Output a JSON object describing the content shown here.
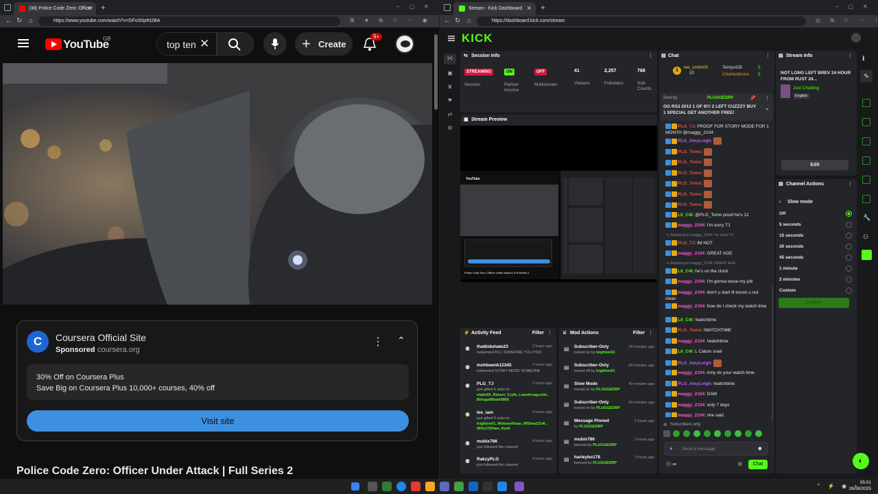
{
  "youtube_window": {
    "tab_title": "(38) Police Code Zero: Officer",
    "url": "https://www.youtube.com/watch?v=DFoS0ptN2BA",
    "logo_text": "YouTube",
    "region": "GB",
    "search_value": "top ten",
    "create_label": "Create",
    "notification_count": "9+",
    "ad": {
      "advertiser": "Coursera Official Site",
      "sponsored": "Sponsored",
      "domain": "coursera.org",
      "avatar_letter": "C",
      "offer_title": "30% Off on Coursera Plus",
      "offer_text": "Save Big on Coursera Plus 10,000+ courses, 40% off",
      "cta": "Visit site"
    },
    "video_title": "Police Code Zero: Officer Under Attack | Full Series 2"
  },
  "kick_window": {
    "tab_title": "Stream - Kick Dashboard",
    "url": "https://dashboard.kick.com/stream",
    "logo": "KICK",
    "session_info": {
      "title": "Session Info",
      "stats": [
        {
          "badge": "STREAMING",
          "label": "Session"
        },
        {
          "badge": "ON",
          "label": "Partner Income"
        },
        {
          "badge": "OFF",
          "label": "Multistream"
        },
        {
          "value": "41",
          "label": "Viewers"
        },
        {
          "value": "2,257",
          "label": "Followers"
        },
        {
          "value": "768",
          "label": "Sub Counts"
        }
      ]
    },
    "stream_preview": {
      "title": "Stream Preview",
      "caption": "Police Code Zero: Officer Under Attack | Full Series 2",
      "mini_logo": "YouTube"
    },
    "activity_feed": {
      "title": "Activity Feed",
      "filter": "Filter",
      "items": [
        {
          "user": "thatkiduhate23",
          "time": "2 hours ago",
          "line1": "redeemed KILL SOMEONE YOU PICK",
          "line2": ""
        },
        {
          "user": "mohbeenk12345",
          "time": "2 hours ago",
          "line1": "redeemed STORY MODE SOMEONE",
          "line2": ""
        },
        {
          "user": "PLG_TJ",
          "time": "2 hours ago",
          "line1": "just gifted 5 subs to:",
          "line2": "slatts55, Rimuri, Crytk, Leandroagustin, BelugaWhale6868"
        },
        {
          "user": "lee_iam",
          "time": "4 hours ago",
          "line1": "just gifted 5 subs to:",
          "line2": "leighton01, MobeenKhan, WDmwZZnK, WHyClSHaw, Ayo6"
        },
        {
          "user": "mubix786",
          "time": "4 hours ago",
          "line1": "just followed the channel",
          "line2": ""
        },
        {
          "user": "RakzyPLG",
          "time": "4 hours ago",
          "line1": "just followed the channel",
          "line2": ""
        }
      ]
    },
    "mod_actions": {
      "title": "Mod Actions",
      "filter": "Filter",
      "items": [
        {
          "action": "Subscriber-Only",
          "time": "39 minutes ago",
          "line": "turned on by",
          "by": "leighton01"
        },
        {
          "action": "Subscriber-Only",
          "time": "40 minutes ago",
          "line": "turned off by",
          "by": "leighton01"
        },
        {
          "action": "Slow Mode",
          "time": "40 minutes ago",
          "line": "turned on by",
          "by": "PLUGGEDRP"
        },
        {
          "action": "Subscriber-Only",
          "time": "43 minutes ago",
          "line": "turned on by",
          "by": "PLUGGEDRP"
        },
        {
          "action": "Message Pinned",
          "time": "2 hours ago",
          "line": "by",
          "by": "PLUGGEDRP"
        },
        {
          "action": "mubix786",
          "time": "3 hours ago",
          "line": "banned by",
          "by": "PLUGGEDRP"
        },
        {
          "action": "harleybo178",
          "time": "3 hours ago",
          "line": "banned by",
          "by": "PLUGGEDRP"
        }
      ]
    },
    "chat": {
      "title": "Chat",
      "top_gifters": [
        {
          "name": "lee_smith05",
          "count": "10"
        },
        {
          "name": "TempoGB",
          "count": "5"
        },
        {
          "name": "Charlesbrono",
          "count": "5"
        }
      ],
      "pinned": {
        "sent_by": "Sent by",
        "sender": "PLUGGEDRP",
        "text": "OG RS3 2012 1 OF 8!!! 2 LEFT CUZZZY BUY 1 SPECIAL GET ANOTHER FREE!"
      },
      "messages": [
        {
          "user": "PLG_TJ",
          "color": "#e84d4d",
          "text": "PROOF FOR STORY MODE FOR 1 MONTH @maggy_2104"
        },
        {
          "user": "PLG_AmyLeigh",
          "color": "#c45cff",
          "text": ""
        },
        {
          "user": "PLG_Tomo",
          "color": "#e84d4d",
          "text": ""
        },
        {
          "user": "PLG_Tomo",
          "color": "#e84d4d",
          "text": ""
        },
        {
          "user": "PLG_Tomo",
          "color": "#e84d4d",
          "text": ""
        },
        {
          "user": "PLG_Tomo",
          "color": "#e84d4d",
          "text": ""
        },
        {
          "user": "PLG_Tomo",
          "color": "#e84d4d",
          "text": ""
        },
        {
          "user": "PLG_Tomo",
          "color": "#e84d4d",
          "text": ""
        },
        {
          "user": "Lil_C4t",
          "color": "#53fc18",
          "text": "@PLG_Tomo proof he's 12"
        },
        {
          "user": "maggy_2104",
          "color": "#ff5ad0",
          "text": "I'm sorry TJ"
        },
        {
          "reply": "Replying to maggy_2104: I'm sorry TJ",
          "user": "PLG_TJ",
          "color": "#e84d4d",
          "text": "IM NOT"
        },
        {
          "user": "maggy_2104",
          "color": "#ff5ad0",
          "text": "GREAT AGE"
        },
        {
          "reply": "Replying to maggy_2104: GREAT AGE",
          "user": "Lil_C4t",
          "color": "#53fc18",
          "text": "he's on the clock"
        },
        {
          "user": "maggy_2104",
          "color": "#ff5ad0",
          "text": "I'm gonna loose my job"
        },
        {
          "user": "maggy_2104",
          "color": "#ff5ad0",
          "text": "don't u start ill knock u out clean"
        },
        {
          "user": "maggy_2104",
          "color": "#ff5ad0",
          "text": "how do I check my watch time"
        },
        {
          "user": "Lil_C4t",
          "color": "#53fc18",
          "text": "!watchtime"
        },
        {
          "user": "PLG_Tomo",
          "color": "#e84d4d",
          "text": "!WATCHTIME"
        },
        {
          "user": "maggy_2104",
          "color": "#ff5ad0",
          "text": "!watchtime"
        },
        {
          "user": "Lil_C4t",
          "color": "#53fc18",
          "text": "L Calum snail"
        },
        {
          "user": "PLG_AmyLeigh",
          "color": "#c45cff",
          "text": ""
        },
        {
          "user": "maggy_2104",
          "color": "#ff5ad0",
          "text": "Amy do your watch time"
        },
        {
          "user": "PLG_AmyLeigh",
          "color": "#c45cff",
          "text": "!watchtime"
        },
        {
          "user": "maggy_2104",
          "color": "#ff5ad0",
          "text": "DAM"
        },
        {
          "user": "maggy_2104",
          "color": "#ff5ad0",
          "text": "only 7 days"
        },
        {
          "user": "maggy_2104",
          "color": "#ff5ad0",
          "text": "she said"
        }
      ],
      "subscribers_only": "Subscribers only",
      "input_placeholder": "Send a message",
      "send_label": "Chat"
    },
    "stream_info": {
      "title": "Stream Info",
      "stream_title": "NOT LONG LEFT BREV 24 HOUR FROM RUST 24...",
      "category": "Just Chatting",
      "language": "English",
      "edit": "Edit"
    },
    "channel_actions": {
      "title": "Channel Actions",
      "back_label": "Slow mode",
      "options": [
        "Off",
        "5 seconds",
        "15 seconds",
        "30 seconds",
        "45 seconds",
        "1 minute",
        "2 minutes",
        "Custom"
      ],
      "selected": "Off",
      "confirm": "Confirm"
    }
  },
  "taskbar": {
    "time": "05:01",
    "date": "26/08/2025"
  },
  "colors": {
    "kick_green": "#53fc18",
    "yt_red": "#ff0000",
    "coursera_blue": "#3d8fe0"
  }
}
